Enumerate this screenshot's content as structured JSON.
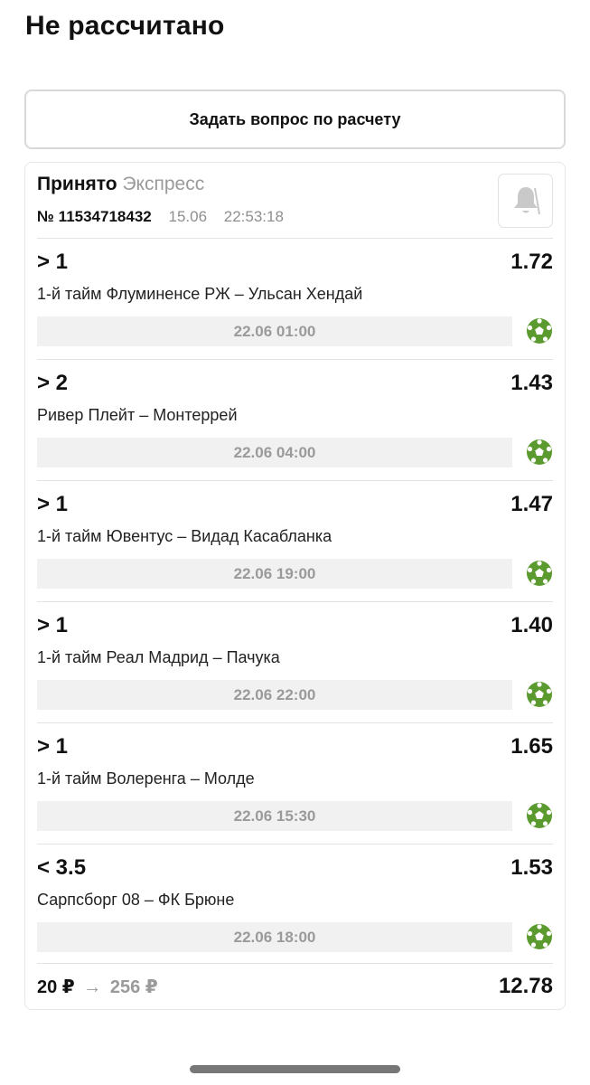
{
  "header": {
    "title": "Не рассчитано"
  },
  "ask_button": {
    "label": "Задать вопрос по расчету"
  },
  "bet": {
    "status": "Принято",
    "type": "Экспресс",
    "number": "№ 11534718432",
    "date": "15.06",
    "time": "22:53:18",
    "notify_icon": "bell-icon",
    "selections": [
      {
        "outcome": "> 1",
        "odds": "1.72",
        "event": "1-й тайм Флуминенсе РЖ – Ульсан Хендай",
        "start": "22.06 01:00",
        "sport_icon": "soccer-ball-icon"
      },
      {
        "outcome": "> 2",
        "odds": "1.43",
        "event": "Ривер Плейт – Монтеррей",
        "start": "22.06 04:00",
        "sport_icon": "soccer-ball-icon"
      },
      {
        "outcome": "> 1",
        "odds": "1.47",
        "event": "1-й тайм Ювентус – Видад Касабланка",
        "start": "22.06 19:00",
        "sport_icon": "soccer-ball-icon"
      },
      {
        "outcome": "> 1",
        "odds": "1.40",
        "event": "1-й тайм Реал Мадрид – Пачука",
        "start": "22.06 22:00",
        "sport_icon": "soccer-ball-icon"
      },
      {
        "outcome": "> 1",
        "odds": "1.65",
        "event": "1-й тайм Волеренга – Молде",
        "start": "22.06 15:30",
        "sport_icon": "soccer-ball-icon"
      },
      {
        "outcome": "< 3.5",
        "odds": "1.53",
        "event": "Сарпсборг 08 – ФК Брюне",
        "start": "22.06 18:00",
        "sport_icon": "soccer-ball-icon"
      }
    ],
    "stake": "20 ₽",
    "arrow": "→",
    "potential_payout": "256 ₽",
    "total_odds": "12.78"
  },
  "colors": {
    "sport_icon": "#5a9a2e",
    "muted_text": "#9a9a9a",
    "time_bg": "#f1f1f1"
  }
}
